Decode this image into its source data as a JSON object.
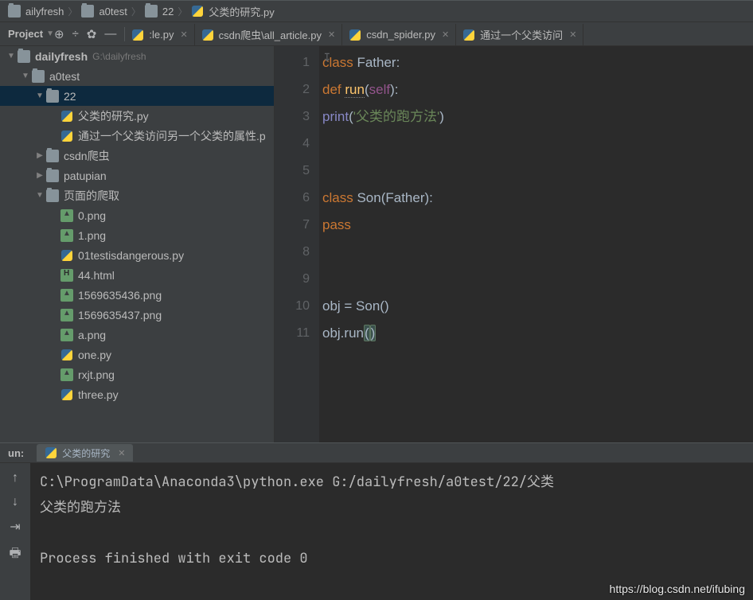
{
  "breadcrumb": [
    {
      "icon": "folder",
      "label": "ailyfresh"
    },
    {
      "icon": "folder",
      "label": "a0test"
    },
    {
      "icon": "folder",
      "label": "22"
    },
    {
      "icon": "py",
      "label": "父类的研究.py"
    }
  ],
  "project_label": "Project",
  "project_tree": [
    {
      "depth": 0,
      "arrow": "▼",
      "icon": "folder",
      "name": "dailyfresh",
      "path": "G:\\dailyfresh",
      "bold": true
    },
    {
      "depth": 1,
      "arrow": "▼",
      "icon": "folder",
      "name": "a0test"
    },
    {
      "depth": 2,
      "arrow": "▼",
      "icon": "folder",
      "name": "22",
      "sel": true
    },
    {
      "depth": 3,
      "arrow": "",
      "icon": "py",
      "name": "父类的研究.py"
    },
    {
      "depth": 3,
      "arrow": "",
      "icon": "py",
      "name": "通过一个父类访问另一个父类的属性.p"
    },
    {
      "depth": 2,
      "arrow": "▶",
      "icon": "folder",
      "name": "csdn爬虫"
    },
    {
      "depth": 2,
      "arrow": "▶",
      "icon": "folder",
      "name": "patupian"
    },
    {
      "depth": 2,
      "arrow": "▼",
      "icon": "folder",
      "name": "页面的爬取"
    },
    {
      "depth": 3,
      "arrow": "",
      "icon": "png",
      "name": "0.png"
    },
    {
      "depth": 3,
      "arrow": "",
      "icon": "png",
      "name": "1.png"
    },
    {
      "depth": 3,
      "arrow": "",
      "icon": "py",
      "name": "01testisdangerous.py"
    },
    {
      "depth": 3,
      "arrow": "",
      "icon": "html",
      "name": "44.html"
    },
    {
      "depth": 3,
      "arrow": "",
      "icon": "png",
      "name": "1569635436.png"
    },
    {
      "depth": 3,
      "arrow": "",
      "icon": "png",
      "name": "1569635437.png"
    },
    {
      "depth": 3,
      "arrow": "",
      "icon": "png",
      "name": "a.png"
    },
    {
      "depth": 3,
      "arrow": "",
      "icon": "py",
      "name": "one.py"
    },
    {
      "depth": 3,
      "arrow": "",
      "icon": "png",
      "name": "rxjt.png"
    },
    {
      "depth": 3,
      "arrow": "",
      "icon": "py",
      "name": "three.py"
    }
  ],
  "tabs": [
    {
      "icon": "py",
      "label": ":le.py"
    },
    {
      "icon": "py",
      "label": "csdn爬虫\\all_article.py"
    },
    {
      "icon": "py",
      "label": "csdn_spider.py"
    },
    {
      "icon": "py",
      "label": "通过一个父类访问"
    }
  ],
  "code_lines": [
    "1",
    "2",
    "3",
    "4",
    "5",
    "6",
    "7",
    "8",
    "9",
    "10",
    "11"
  ],
  "code": {
    "l1_kw": "class",
    "l1_cls": " Father:",
    "l2_kw": "def ",
    "l2_fn": "run",
    "l2_rest": "(",
    "l2_self": "self",
    "l2_close": "):",
    "l3_fn": "print",
    "l3_par": "(",
    "l3_str": "'父类的跑方法'",
    "l3_close": ")",
    "l6_kw": "class",
    "l6_cls": " Son(Father):",
    "l7_kw": "pass",
    "l10": "obj = Son()",
    "l11_a": "obj.run",
    "l11_p1": "(",
    "l11_p2": ")"
  },
  "run_label": "un:",
  "run_tab": "父类的研究",
  "console": "C:\\ProgramData\\Anaconda3\\python.exe G:/dailyfresh/a0test/22/父类\n父类的跑方法\n\nProcess finished with exit code 0",
  "watermark": "https://blog.csdn.net/ifubing"
}
